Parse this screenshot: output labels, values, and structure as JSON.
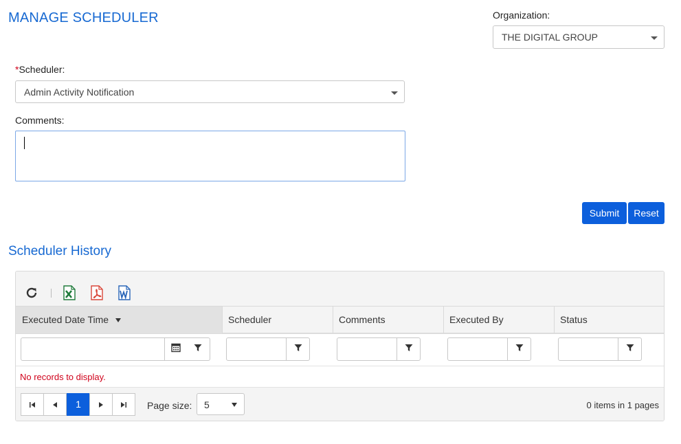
{
  "page": {
    "title": "MANAGE SCHEDULER"
  },
  "organization": {
    "label": "Organization:",
    "value": "THE DIGITAL GROUP"
  },
  "scheduler": {
    "required_mark": "*",
    "label": "Scheduler:",
    "value": "Admin Activity Notification"
  },
  "comments": {
    "label": "Comments:",
    "value": ""
  },
  "buttons": {
    "submit": "Submit",
    "reset": "Reset"
  },
  "history": {
    "title": "Scheduler History",
    "toolbar": {
      "icons": [
        "refresh-icon",
        "excel-icon",
        "pdf-icon",
        "word-icon"
      ]
    },
    "columns": [
      "Executed Date Time",
      "Scheduler",
      "Comments",
      "Executed By",
      "Status"
    ],
    "empty_message": "No records to display.",
    "pager": {
      "current_page": "1",
      "page_size_label": "Page size:",
      "page_size": "5",
      "info": "0 items in 1 pages"
    }
  },
  "colors": {
    "accent": "#0c5fdc",
    "title": "#1769d2",
    "error": "#d0021b",
    "excel": "#1f7a3a",
    "pdf": "#d9473a",
    "word": "#2a66b8"
  }
}
